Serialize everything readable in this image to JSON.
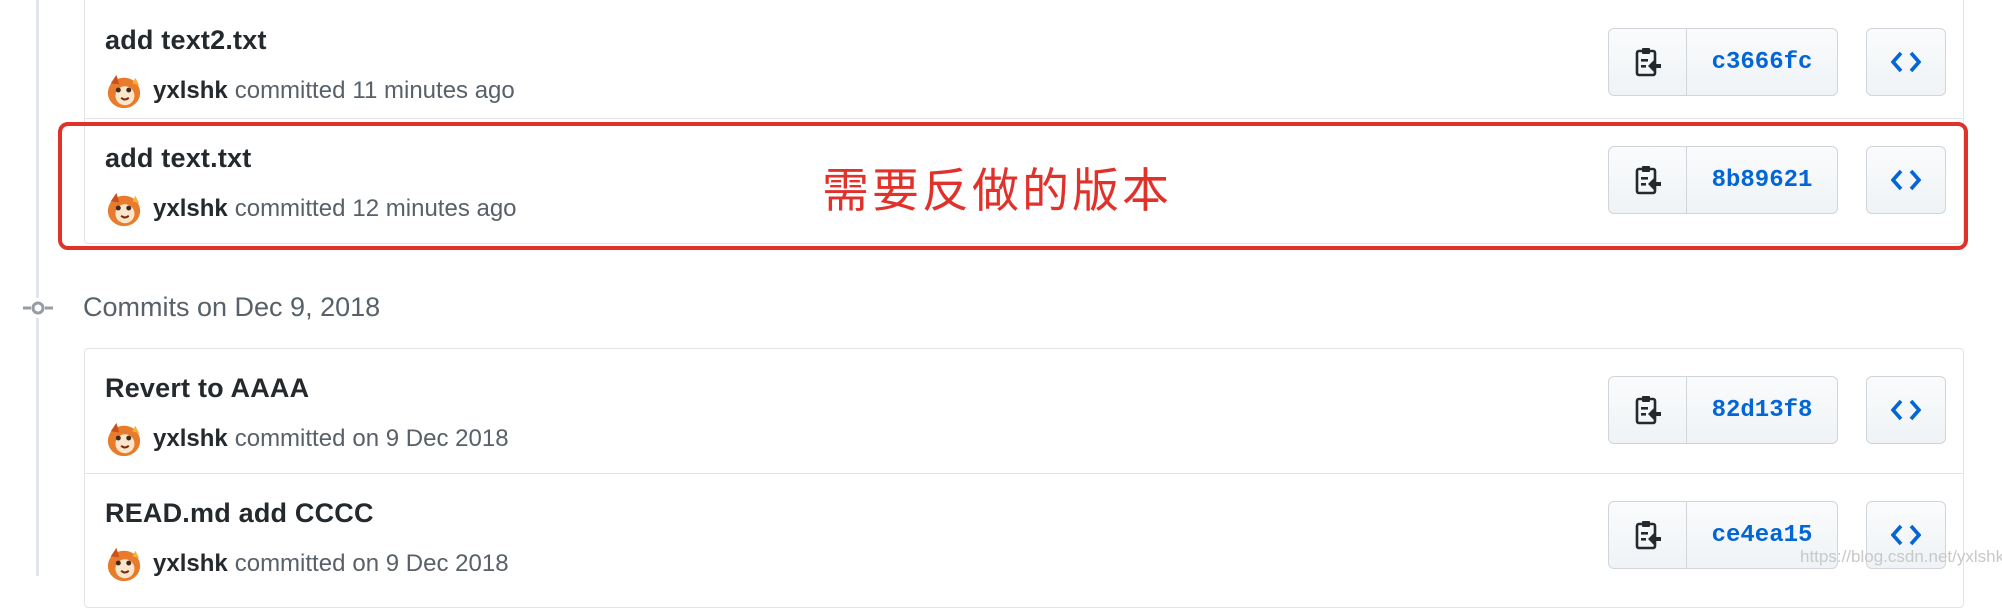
{
  "annotation": {
    "text": "需要反做的版本",
    "color": "#e0322b"
  },
  "date_heading": "Commits on Dec 9, 2018",
  "groups": [
    {
      "commits": [
        {
          "message": "add text2.txt",
          "author": "yxlshk",
          "committed": "committed",
          "time": "11 minutes ago",
          "sha": "c3666fc"
        },
        {
          "message": "add text.txt",
          "author": "yxlshk",
          "committed": "committed",
          "time": "12 minutes ago",
          "sha": "8b89621"
        }
      ]
    },
    {
      "commits": [
        {
          "message": "Revert to AAAA",
          "author": "yxlshk",
          "committed": "committed",
          "time": "on 9 Dec 2018",
          "sha": "82d13f8"
        },
        {
          "message": "READ.md add CCCC",
          "author": "yxlshk",
          "committed": "committed",
          "time": "on 9 Dec 2018",
          "sha": "ce4ea15"
        }
      ]
    }
  ],
  "icons": {
    "copy": "clipboard-icon",
    "browse": "code-icon",
    "timeline": "git-commit-icon",
    "avatar": "avatar-cartoon"
  },
  "colors": {
    "link": "#0366d6",
    "annotation": "#e0322b",
    "border": "#e1e4e8"
  },
  "watermark": "https://blog.csdn.net/yxlshk"
}
